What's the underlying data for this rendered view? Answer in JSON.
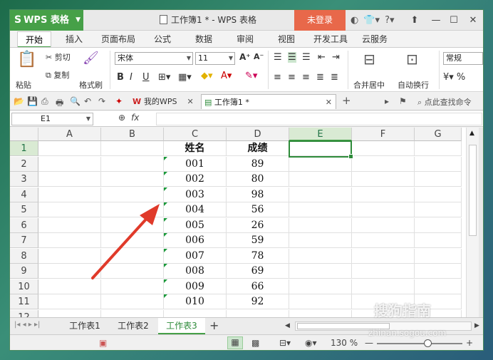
{
  "app": {
    "name": "WPS 表格",
    "title": "工作簿1 * - WPS 表格",
    "login_label": "未登录"
  },
  "ribbon_tabs": [
    {
      "label": "开始"
    },
    {
      "label": "插入"
    },
    {
      "label": "页面布局"
    },
    {
      "label": "公式"
    },
    {
      "label": "数据"
    },
    {
      "label": "审阅"
    },
    {
      "label": "视图"
    },
    {
      "label": "开发工具"
    },
    {
      "label": "云服务"
    }
  ],
  "ribbon": {
    "paste": "粘贴",
    "cut": "剪切",
    "copy": "复制",
    "format_painter": "格式刷",
    "font_name": "宋体",
    "font_size": "11",
    "merge_center": "合并居中",
    "wrap_text": "自动换行",
    "number_format": "常规"
  },
  "quickbar": {
    "doctab_wps": "我的WPS",
    "doctab_book": "工作簿1 *",
    "search": "点此查找命令"
  },
  "formula_bar": {
    "cell_ref": "E1",
    "fx": "fx"
  },
  "columns": [
    "A",
    "B",
    "C",
    "D",
    "E",
    "F",
    "G"
  ],
  "rows": [
    "1",
    "2",
    "3",
    "4",
    "5",
    "6",
    "7",
    "8",
    "9",
    "10",
    "11",
    "12"
  ],
  "table": {
    "header_name": "姓名",
    "header_score": "成绩",
    "data": [
      {
        "name": "001",
        "score": "89"
      },
      {
        "name": "002",
        "score": "80"
      },
      {
        "name": "003",
        "score": "98"
      },
      {
        "name": "004",
        "score": "56"
      },
      {
        "name": "005",
        "score": "26"
      },
      {
        "name": "006",
        "score": "59"
      },
      {
        "name": "007",
        "score": "78"
      },
      {
        "name": "008",
        "score": "69"
      },
      {
        "name": "009",
        "score": "66"
      },
      {
        "name": "010",
        "score": "92"
      }
    ]
  },
  "sheets": [
    {
      "label": "工作表1"
    },
    {
      "label": "工作表2"
    },
    {
      "label": "工作表3"
    }
  ],
  "status": {
    "zoom": "130 %"
  },
  "watermark": {
    "brand": "搜狗指南",
    "url": "zhinan.sogou.com"
  },
  "colors": {
    "accent": "#46a048",
    "login": "#e8684a",
    "arrow": "#e03a2a",
    "marker": "#1a9a3a"
  }
}
